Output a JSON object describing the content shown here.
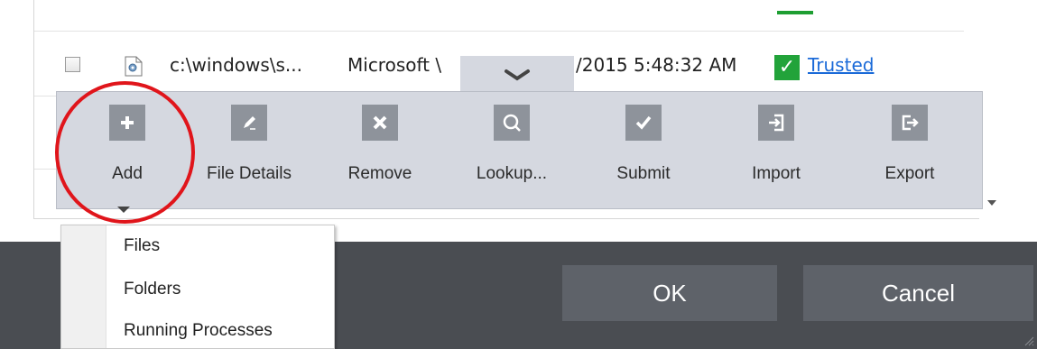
{
  "file_row": {
    "path": "c:\\windows\\s...",
    "vendor": "Microsoft \\",
    "date": "/2015 5:48:32 AM",
    "rating": "Trusted"
  },
  "toolbar": {
    "buttons": [
      {
        "label": "Add",
        "icon": "plus-icon"
      },
      {
        "label": "File Details",
        "icon": "edit-icon"
      },
      {
        "label": "Remove",
        "icon": "x-icon"
      },
      {
        "label": "Lookup...",
        "icon": "search-icon"
      },
      {
        "label": "Submit",
        "icon": "checkmark-icon"
      },
      {
        "label": "Import",
        "icon": "import-icon"
      },
      {
        "label": "Export",
        "icon": "export-icon"
      }
    ]
  },
  "add_menu": {
    "items": [
      "Files",
      "Folders",
      "Running Processes"
    ]
  },
  "dialog": {
    "ok_label": "OK",
    "cancel_label": "Cancel"
  },
  "colors": {
    "toolbar_bg": "#d5d8e0",
    "icon_bg": "#8e939b",
    "trusted_green": "#22a33a",
    "link_blue": "#1a6ad8",
    "highlight_red": "#e0151b",
    "bottom_bar": "#4a4d52"
  }
}
